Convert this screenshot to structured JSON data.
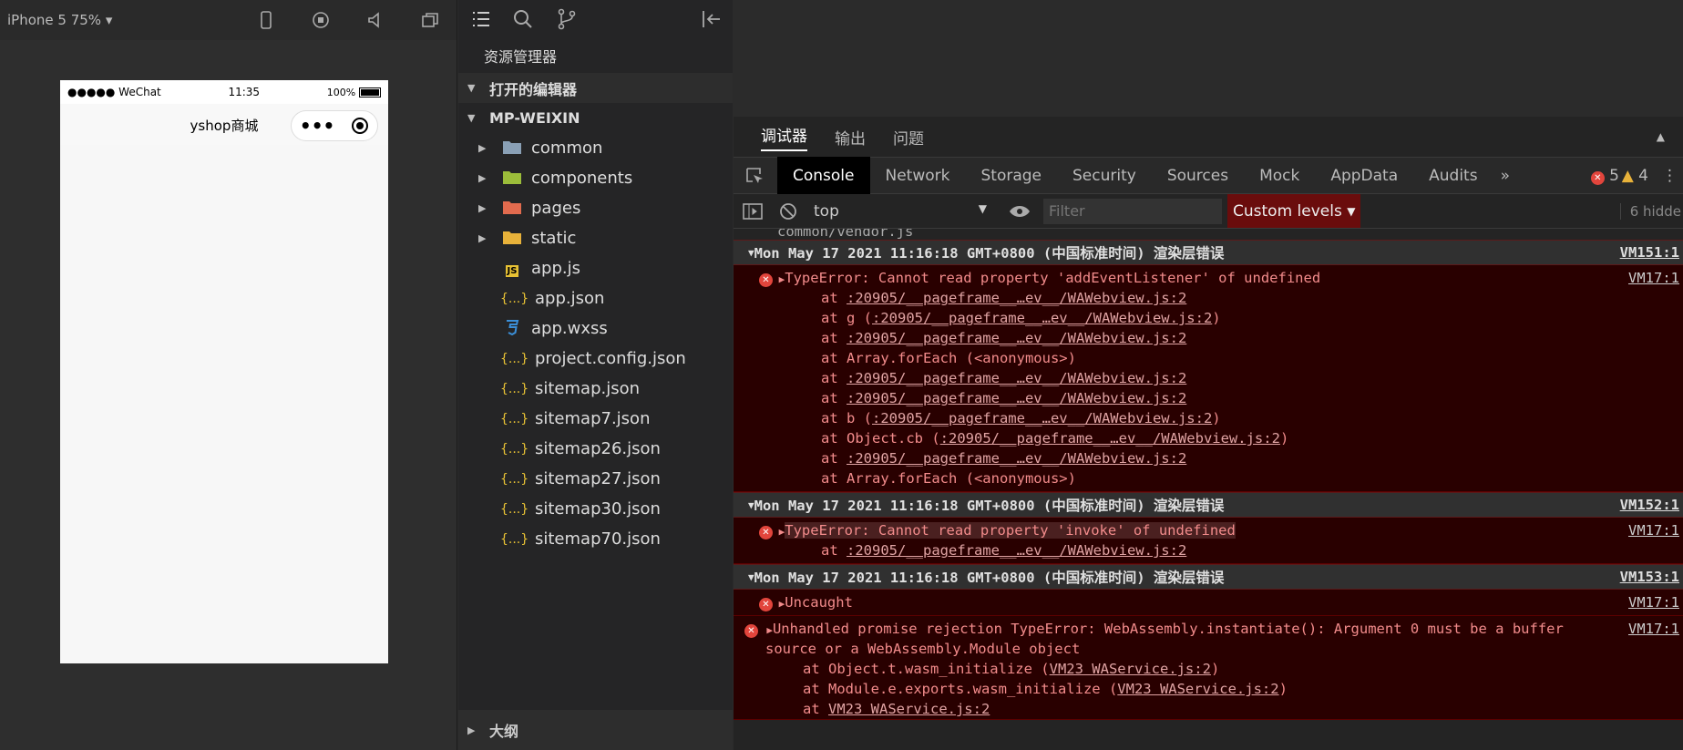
{
  "simulator": {
    "device": "iPhone 5 75% ▾",
    "status_left": "●●●●● WeChat",
    "time": "11:35",
    "battery": "100%",
    "title": "yshop商城",
    "capsule_dots": "•••"
  },
  "explorer": {
    "title": "资源管理器",
    "open_editors": "打开的编辑器",
    "project": "MP-WEIXIN",
    "outline": "大纲",
    "items": [
      {
        "label": "common",
        "icon": "folder",
        "color": "#8aa0b5",
        "folder": true
      },
      {
        "label": "components",
        "icon": "folder",
        "color": "#9cbd3a",
        "folder": true
      },
      {
        "label": "pages",
        "icon": "folder",
        "color": "#e26b4e",
        "folder": true
      },
      {
        "label": "static",
        "icon": "folder",
        "color": "#e8b23a",
        "folder": true
      },
      {
        "label": "app.js",
        "icon": "JS",
        "color": "#e8c234",
        "folder": false
      },
      {
        "label": "app.json",
        "icon": "{...}",
        "color": "#e8c234",
        "folder": false
      },
      {
        "label": "app.wxss",
        "icon": "css",
        "color": "#3b8fd8",
        "folder": false
      },
      {
        "label": "project.config.json",
        "icon": "{...}",
        "color": "#e8c234",
        "folder": false
      },
      {
        "label": "sitemap.json",
        "icon": "{...}",
        "color": "#e8c234",
        "folder": false
      },
      {
        "label": "sitemap7.json",
        "icon": "{...}",
        "color": "#e8c234",
        "folder": false
      },
      {
        "label": "sitemap26.json",
        "icon": "{...}",
        "color": "#e8c234",
        "folder": false
      },
      {
        "label": "sitemap27.json",
        "icon": "{...}",
        "color": "#e8c234",
        "folder": false
      },
      {
        "label": "sitemap30.json",
        "icon": "{...}",
        "color": "#e8c234",
        "folder": false
      },
      {
        "label": "sitemap70.json",
        "icon": "{...}",
        "color": "#e8c234",
        "folder": false
      }
    ]
  },
  "devtools": {
    "top_tabs": [
      "调试器",
      "输出",
      "问题"
    ],
    "panels": [
      "Console",
      "Network",
      "Storage",
      "Security",
      "Sources",
      "Mock",
      "AppData",
      "Audits"
    ],
    "errors": "5",
    "warnings": "4",
    "context": "top",
    "filter_placeholder": "Filter",
    "levels": "Custom levels",
    "hidden": "6 hidde",
    "cut_line": "common/vendor.js",
    "groups": [
      {
        "header": "Mon May 17 2021 11:16:18 GMT+0800 (中国标准时间) 渲染层错误",
        "vm": "VM151:1",
        "msg": "TypeError: Cannot read property 'addEventListener' of undefined",
        "msg_vm": "VM17:1",
        "stack": [
          [
            "at ",
            ":20905/__pageframe__…ev__/WAWebview.js:2",
            ""
          ],
          [
            "at g (",
            ":20905/__pageframe__…ev__/WAWebview.js:2",
            ")"
          ],
          [
            "at ",
            ":20905/__pageframe__…ev__/WAWebview.js:2",
            ""
          ],
          [
            "at Array.forEach (<anonymous>)",
            "",
            ""
          ],
          [
            "at ",
            ":20905/__pageframe__…ev__/WAWebview.js:2",
            ""
          ],
          [
            "at ",
            ":20905/__pageframe__…ev__/WAWebview.js:2",
            ""
          ],
          [
            "at b (",
            ":20905/__pageframe__…ev__/WAWebview.js:2",
            ")"
          ],
          [
            "at Object.cb (",
            ":20905/__pageframe__…ev__/WAWebview.js:2",
            ")"
          ],
          [
            "at ",
            ":20905/__pageframe__…ev__/WAWebview.js:2",
            ""
          ],
          [
            "at Array.forEach (<anonymous>)",
            "",
            ""
          ]
        ]
      },
      {
        "header": "Mon May 17 2021 11:16:18 GMT+0800 (中国标准时间) 渲染层错误",
        "vm": "VM152:1",
        "msg": "TypeError: Cannot read property 'invoke' of undefined",
        "msg_vm": "VM17:1",
        "stack": [
          [
            "at ",
            ":20905/__pageframe__…ev__/WAWebview.js:2",
            ""
          ]
        ]
      },
      {
        "header": "Mon May 17 2021 11:16:18 GMT+0800 (中国标准时间) 渲染层错误",
        "vm": "VM153:1",
        "msg": "Uncaught",
        "msg_vm": "VM17:1",
        "stack": []
      }
    ],
    "unhandled": {
      "line1": "Unhandled promise rejection TypeError: WebAssembly.instantiate(): Argument 0 must be a buffer",
      "line2": "source or a WebAssembly.Module object",
      "vm": "VM17:1",
      "stack": [
        [
          "at Object.t.wasm_initialize (",
          "VM23 WAService.js:2",
          ")"
        ],
        [
          "at Module.e.exports.wasm_initialize (",
          "VM23 WAService.js:2",
          ")"
        ],
        [
          "at ",
          "VM23 WAService.js:2",
          ""
        ]
      ]
    }
  }
}
